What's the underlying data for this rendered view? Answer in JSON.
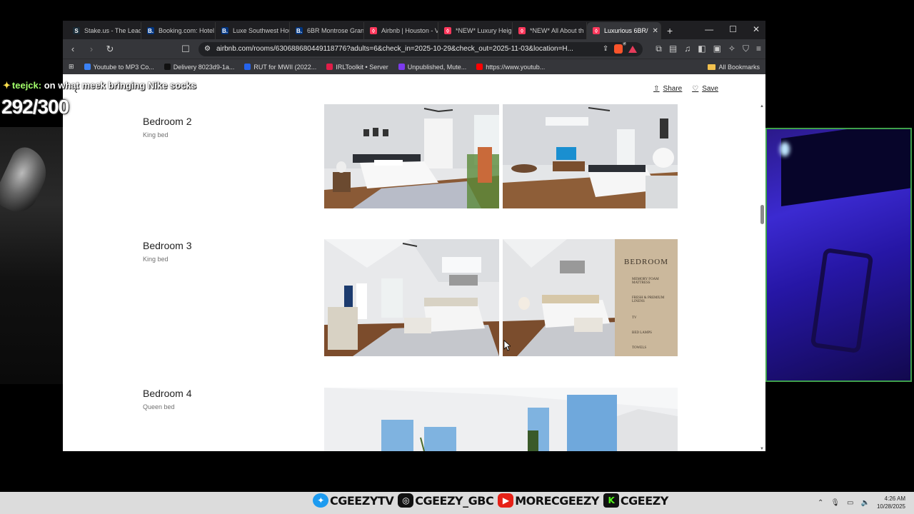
{
  "overlay": {
    "chat_user": "teejck:",
    "chat_message": "on what meek bringing Nike socks",
    "counter": "292/300"
  },
  "browser": {
    "tabs": [
      {
        "label": "Stake.us - The Leadi",
        "favicon": "S"
      },
      {
        "label": "Booking.com: Hotel",
        "favicon": "B."
      },
      {
        "label": "Luxe Southwest Hou",
        "favicon": "B."
      },
      {
        "label": "6BR Montrose Gran",
        "favicon": "B."
      },
      {
        "label": "Airbnb | Houston - V",
        "favicon": "airbnb-icon"
      },
      {
        "label": "*NEW* Luxury Heig",
        "favicon": "airbnb-icon"
      },
      {
        "label": "*NEW* All About th",
        "favicon": "airbnb-icon"
      },
      {
        "label": "Luxurious 6BR/",
        "favicon": "airbnb-icon",
        "active": true
      }
    ],
    "url": "airbnb.com/rooms/630688680449118776?adults=6&check_in=2025-10-29&check_out=2025-11-03&location=H...",
    "brave_badge": "2",
    "bookmarks": [
      {
        "label": "Youtube to MP3 Co...",
        "color": "#3b82f6"
      },
      {
        "label": "Delivery 8023d9-1a...",
        "color": "#111111"
      },
      {
        "label": "RUT for MWII (2022...",
        "color": "#2563eb"
      },
      {
        "label": "IRLToolkit • Server",
        "color": "#e11d48"
      },
      {
        "label": "Unpublished, Mute...",
        "color": "#7c3aed"
      },
      {
        "label": "https://www.youtub...",
        "color": "#ff0000"
      }
    ],
    "all_bookmarks": "All Bookmarks"
  },
  "page": {
    "share": "Share",
    "save": "Save",
    "rooms": [
      {
        "name": "Bedroom 2",
        "bed": "King bed"
      },
      {
        "name": "Bedroom 3",
        "bed": "King bed"
      },
      {
        "name": "Bedroom 4",
        "bed": "Queen bed"
      }
    ],
    "promo": {
      "title": "BEDROOM",
      "items": [
        "MEMORY FOAM MATTRESS",
        "FRESH & PREMIUM LINENS",
        "TV",
        "BED LAMPS",
        "TOWELS"
      ]
    }
  },
  "footer": {
    "socials": [
      {
        "icon": "twitter-icon",
        "handle": "CGEEZYTV"
      },
      {
        "icon": "instagram-icon",
        "handle": "CGEEZY_GBC"
      },
      {
        "icon": "youtube-icon",
        "handle": "MORECGEEZY"
      },
      {
        "icon": "kick-icon",
        "handle": "CGEEZY"
      }
    ],
    "time": "4:26 AM",
    "date": "10/28/2025"
  }
}
